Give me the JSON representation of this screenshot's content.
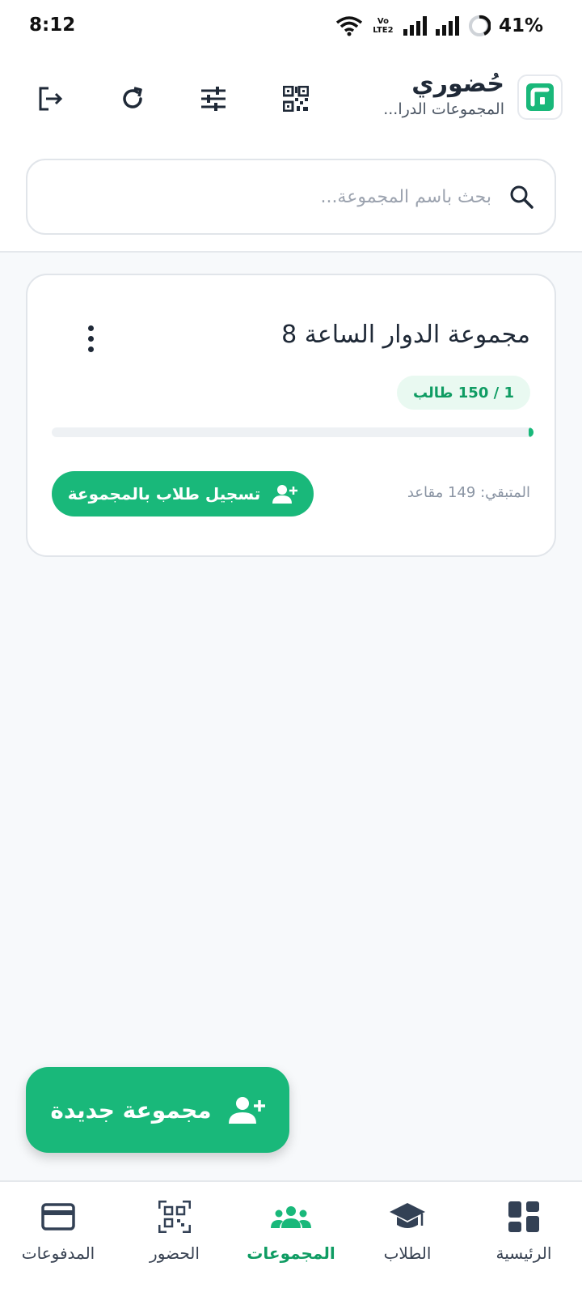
{
  "status_bar": {
    "time": "8:12",
    "battery": "41%",
    "network_label": "Vo LTE2"
  },
  "header": {
    "title": "حُضوري",
    "subtitle": "المجموعات الدرا...",
    "buttons": [
      "qr-code-icon",
      "sliders-icon",
      "refresh-icon",
      "logout-icon"
    ]
  },
  "search": {
    "placeholder": "بحث باسم المجموعة...",
    "value": ""
  },
  "groups": [
    {
      "name": "مجموعة الدوار الساعة 8",
      "count_label": "1 / 150 طالب",
      "enrolled": 1,
      "capacity": 150,
      "remaining_label": "المتبقي: 149 مقاعد",
      "register_label": "تسجيل طلاب بالمجموعة"
    }
  ],
  "fab": {
    "label": "مجموعة جديدة"
  },
  "bottom_nav": {
    "items": [
      {
        "label": "الرئيسية",
        "icon": "dashboard-icon"
      },
      {
        "label": "الطلاب",
        "icon": "graduation-cap-icon"
      },
      {
        "label": "المجموعات",
        "icon": "groups-icon",
        "active": true
      },
      {
        "label": "الحضور",
        "icon": "qr-scan-icon"
      },
      {
        "label": "المدفوعات",
        "icon": "credit-card-icon"
      }
    ]
  },
  "colors": {
    "accent": "#19b87a",
    "accent_text": "#0f9c63",
    "chip_bg": "#e9f9f1",
    "background": "#f7f9fb"
  }
}
